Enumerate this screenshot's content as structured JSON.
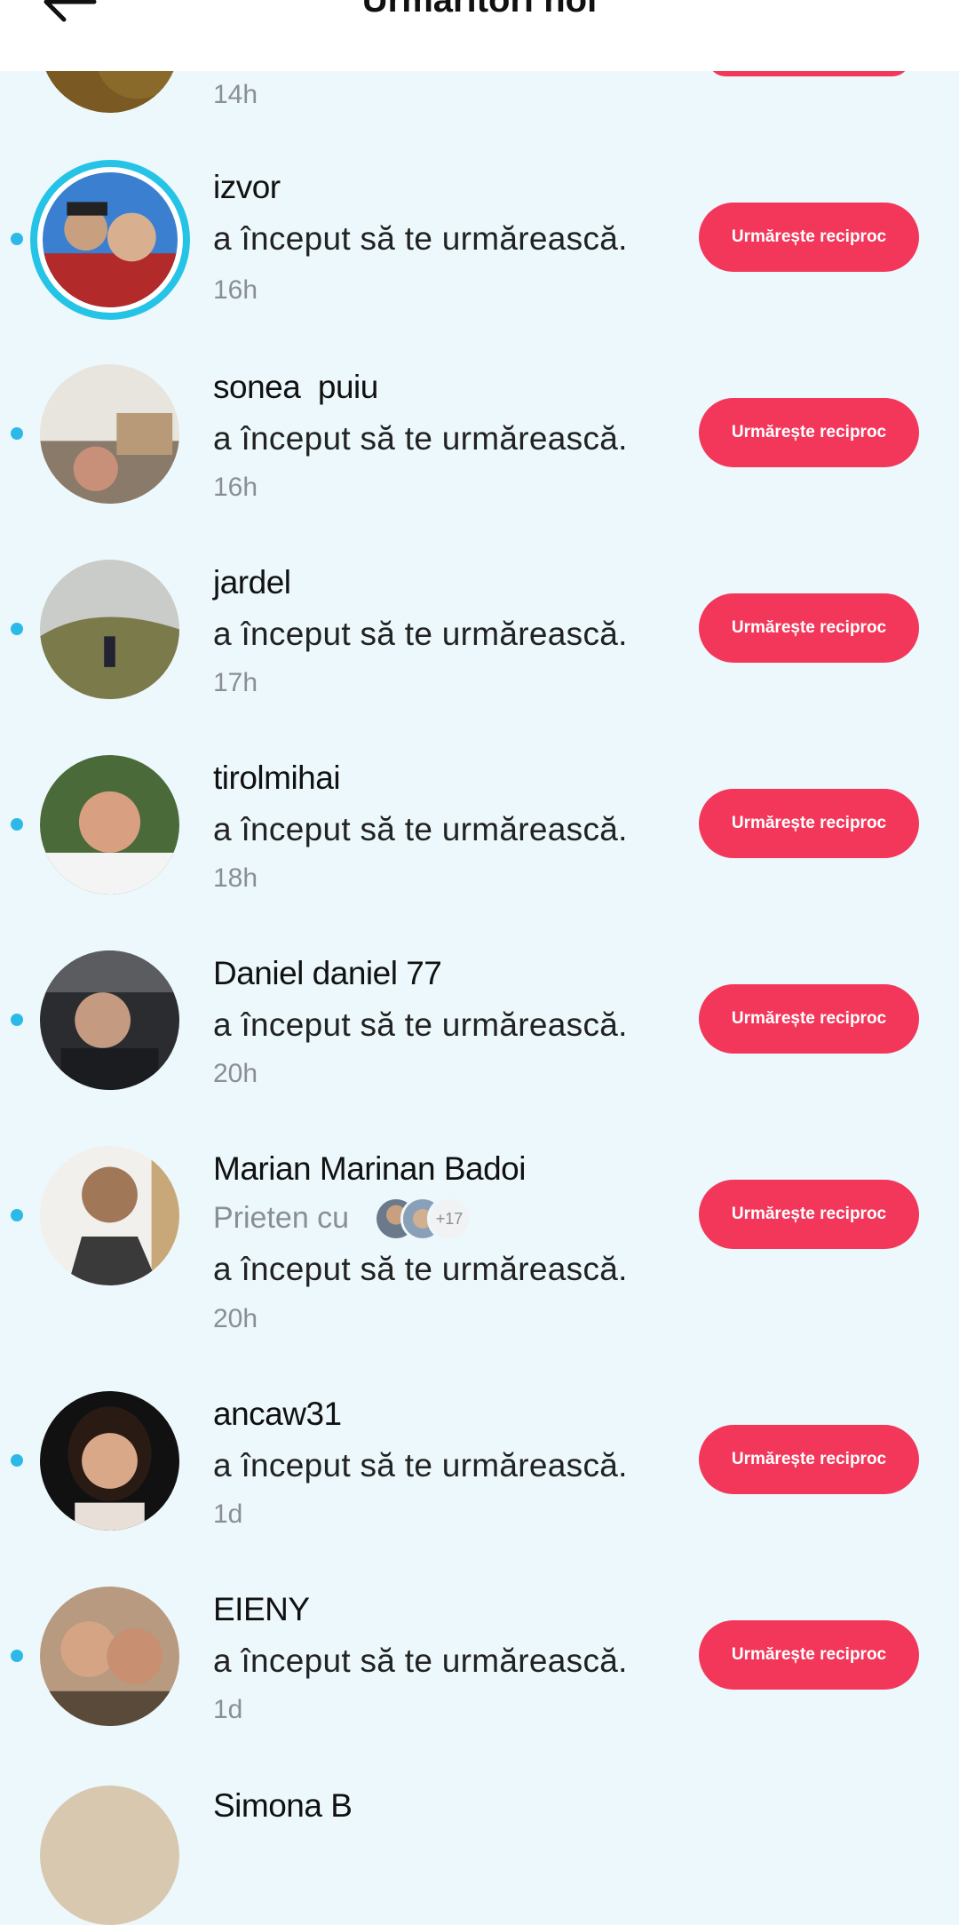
{
  "header": {
    "title": "Urmăritori noi",
    "back_icon": "arrow-left-icon"
  },
  "colors": {
    "accent": "#f2375a",
    "unread_dot": "#2db9e8",
    "story_ring": "#25c3e6",
    "background": "#ecf8fb"
  },
  "button_label": "Urmărește reciproc",
  "top_partial": {
    "time": "14h"
  },
  "rows": [
    {
      "name": "izvor",
      "action": "a început să te urmărească.",
      "time": "16h"
    },
    {
      "name": "sonea  puiu",
      "action": "a început să te urmărească.",
      "time": "16h"
    },
    {
      "name": "jardel",
      "action": "a început să te urmărească.",
      "time": "17h"
    },
    {
      "name": "tirolmihai",
      "action": "a început să te urmărească.",
      "time": "18h"
    },
    {
      "name": "Daniel daniel 77",
      "action": "a început să te urmărească.",
      "time": "20h"
    },
    {
      "name": "Marian Marinan Badoi",
      "friends_label": "Prieten cu",
      "friends_count": "+17",
      "action": "a început să te urmărească.",
      "time": "20h"
    },
    {
      "name": "ancaw31",
      "action": "a început să te urmărească.",
      "time": "1d"
    },
    {
      "name": "EIENY",
      "action": "a început să te urmărească.",
      "time": "1d"
    }
  ],
  "bottom_partial": {
    "name": "Simona B"
  }
}
